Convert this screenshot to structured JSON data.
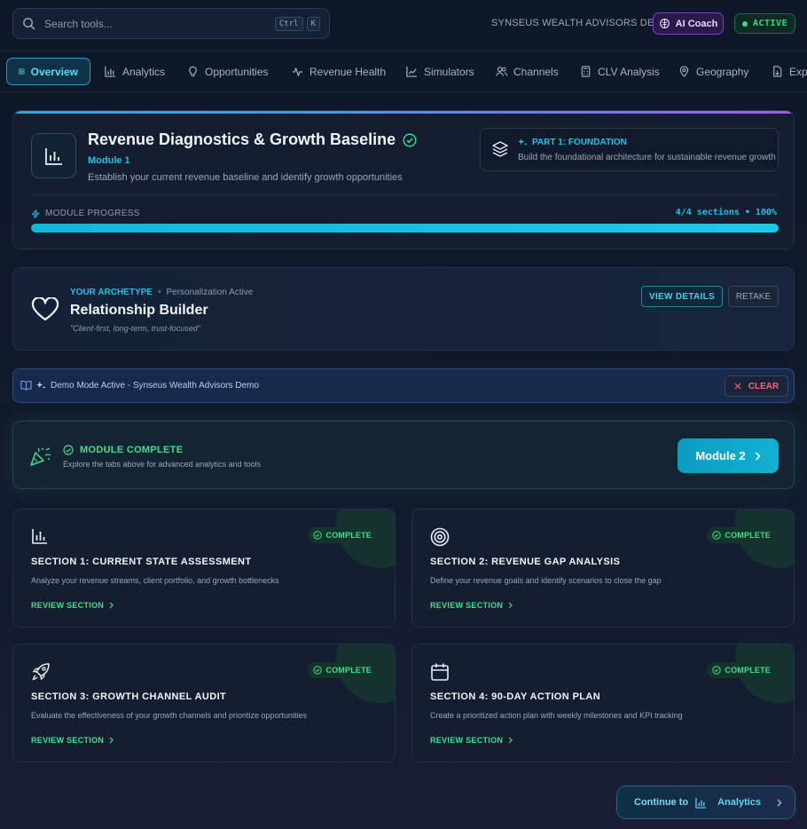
{
  "search": {
    "placeholder": "Search tools...",
    "kbd1": "Ctrl",
    "kbd2": "K"
  },
  "header": {
    "org": "SYNSEUS WEALTH ADVISORS DEMO",
    "ai_coach": "AI Coach",
    "status": "ACTIVE"
  },
  "tabs": [
    {
      "label": "Overview",
      "icon": "grid-icon",
      "active": true
    },
    {
      "label": "Analytics",
      "icon": "bar-chart-icon"
    },
    {
      "label": "Opportunities",
      "icon": "lightbulb-icon"
    },
    {
      "label": "Revenue Health",
      "icon": "pulse-icon"
    },
    {
      "label": "Simulators",
      "icon": "line-chart-icon"
    },
    {
      "label": "Channels",
      "icon": "users-icon"
    },
    {
      "label": "CLV Analysis",
      "icon": "calculator-icon"
    },
    {
      "label": "Geography",
      "icon": "map-pin-icon"
    },
    {
      "label": "Exp",
      "icon": "file-export-icon"
    }
  ],
  "module": {
    "title": "Revenue Diagnostics & Growth Baseline",
    "subtitle": "Module 1",
    "description": "Establish your current revenue baseline and identify growth opportunities",
    "part_title": "PART 1: FOUNDATION",
    "part_description": "Build the foundational architecture for sustainable revenue growth",
    "progress_label": "MODULE PROGRESS",
    "progress_count": "4/4 sections • 100%",
    "progress_value": 1.0
  },
  "archetype": {
    "kicker": "YOUR ARCHETYPE",
    "separator": "•",
    "status": "Personalization Active",
    "name": "Relationship Builder",
    "quote": "\"Client-first, long-term, trust-focused\"",
    "view_details": "VIEW DETAILS",
    "retake": "RETAKE"
  },
  "demo": {
    "text": "Demo Mode Active - Synseus Wealth Advisors Demo",
    "clear": "CLEAR"
  },
  "completion": {
    "title": "MODULE COMPLETE",
    "description": "Explore the tabs above for advanced analytics and tools",
    "next_button": "Module 2"
  },
  "sections": [
    {
      "title": "SECTION 1: CURRENT STATE ASSESSMENT",
      "description": "Analyze your revenue streams, client portfolio, and growth bottlenecks",
      "badge": "COMPLETE",
      "link": "REVIEW SECTION",
      "icon": "bar-chart-icon"
    },
    {
      "title": "SECTION 2: REVENUE GAP ANALYSIS",
      "description": "Define your revenue goals and identify scenarios to close the gap",
      "badge": "COMPLETE",
      "link": "REVIEW SECTION",
      "icon": "target-icon"
    },
    {
      "title": "SECTION 3: GROWTH CHANNEL AUDIT",
      "description": "Evaluate the effectiveness of your growth channels and prioritize opportunities",
      "badge": "COMPLETE",
      "link": "REVIEW SECTION",
      "icon": "rocket-icon"
    },
    {
      "title": "SECTION 4: 90-DAY ACTION PLAN",
      "description": "Create a prioritized action plan with weekly milestones and KPI tracking",
      "badge": "COMPLETE",
      "link": "REVIEW SECTION",
      "icon": "calendar-icon"
    }
  ],
  "continue": {
    "prefix": "Continue to",
    "target": "Analytics"
  },
  "colors": {
    "accent": "#1fc2e8",
    "success": "#3ee08e",
    "danger": "#ee6b77",
    "purple": "#7b3fd6"
  }
}
